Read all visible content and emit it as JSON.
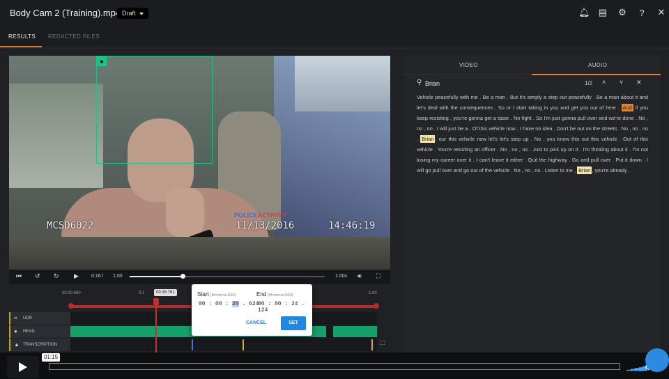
{
  "header": {
    "title": "Body Cam 2 (Training).mp4",
    "status": "Draft",
    "icons": [
      "bell-icon",
      "message-icon",
      "gear-icon",
      "help-icon",
      "close-icon"
    ]
  },
  "tabs": {
    "results": "RESULTS",
    "redacted": "REDACTED FILES"
  },
  "video": {
    "overlay_brand_a": "POLICE",
    "overlay_brand_b": "ACTIVITY",
    "camera_id": "MCSD6022",
    "date": "11/13/2016",
    "time": "14:46:19",
    "current_time": "0:16",
    "duration": "1:00",
    "speed": "1.00x",
    "progress": 0.27
  },
  "timeline": {
    "start_tick": "00:00.000",
    "mid_tick": "0:1",
    "end_tick": "1:00",
    "playhead_label": "00:16.761",
    "tracks": [
      {
        "label": "UDR",
        "icon": "bounding-box-icon"
      },
      {
        "label": "HEAD",
        "icon": "head-icon"
      },
      {
        "label": "TRANSCRIPTION",
        "icon": "transcription-icon"
      }
    ]
  },
  "popup": {
    "start_label": "Start",
    "start_hint": "(hh:mm:ss.SSS)",
    "start_hh": "00",
    "start_mm": "00",
    "start_ss": "20",
    "start_ms": "624",
    "end_label": "End",
    "end_hint": "(hh:mm:ss.SSS)",
    "end_value": "00 : 00 : 24 . 124",
    "cancel": "CANCEL",
    "set": "SET"
  },
  "panel": {
    "tab_video": "VIDEO",
    "tab_audio": "AUDIO",
    "search_value": "Brian",
    "match_count": "1/2",
    "transcript_1": "Vehicle peacefully with me . Be a man . But it's simply a step out peacefully . Be a man about it and let's deal with the consequences . So or I start taking in you and get you out of here .",
    "transcript_hl_cur": "And",
    "transcript_2": "if you keep resisting , you're gonna get a taser . No fight . So I'm just gonna pull over and we're done . No , no , no . I will just be a . Of this vehicle now , I have no idea . Don't be out on the streets . No , no , no .",
    "transcript_hl_1": "Brian",
    "transcript_3": ", our this vehicle now let's let's step up . No , you know this out this vehicle . Out of this vehicle . You're resisting an officer . No , no , no . Just to pick up on it . I'm thinking about it . I'm not losing my career over it . I can't leave it either . Quit the highway . Go and pull over . Put it down . I will go pull over and go out of the vehicle . No , no , no . Listen to me ,",
    "transcript_hl_2": "Brian",
    "transcript_4": ", you're already ."
  },
  "bottom_player": {
    "time_tooltip": "01:15",
    "progress": 0.0
  },
  "colors": {
    "accent": "#e0822d",
    "face_box": "#19c38a",
    "timeline_red": "#b52b2b",
    "head_track": "#16a06a",
    "set_button": "#1e88e5"
  }
}
